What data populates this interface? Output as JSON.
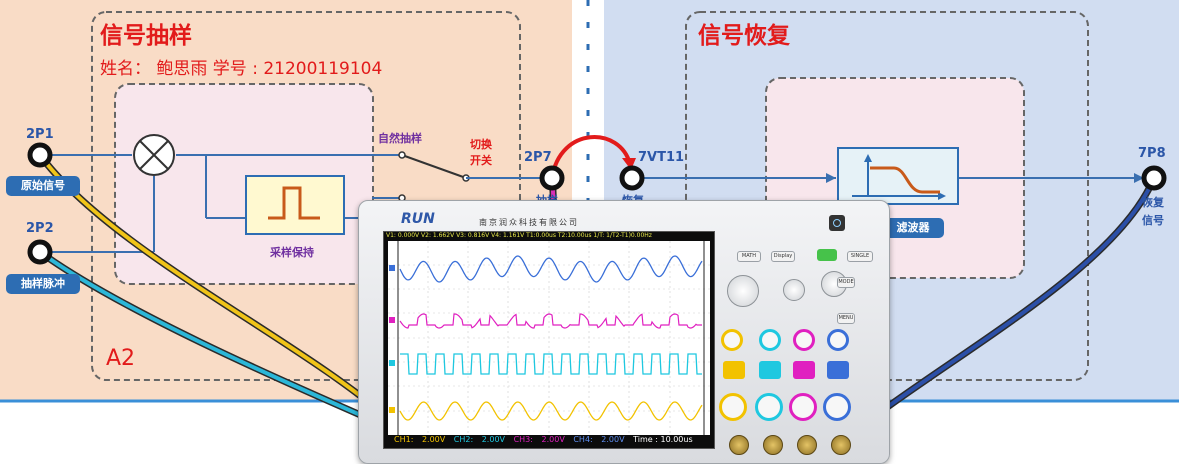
{
  "sampling_panel": {
    "title": "信号抽样",
    "student_line": "姓名： 鲍思雨  学号 : 21200119104",
    "corner_label": "A2",
    "port_2p1": "2P1",
    "port_2p2": "2P2",
    "port_2p7": "2P7",
    "btn_original_signal": "原始信号",
    "btn_sampling_pulse": "抽样脉冲",
    "natural_sampling": "自然抽样",
    "switch_label_line1": "切换",
    "switch_label_line2": "开关",
    "sample_hold": "采样保持",
    "port_2p7_sublabel": "抽样"
  },
  "recovery_panel": {
    "title": "信号恢复",
    "port_7vt11": "7VT11",
    "port_7p8": "7P8",
    "port_7vt11_sublabel": "恢复",
    "filter_label": "滤波器",
    "out_label_line1": "恢复",
    "out_label_line2": "信号"
  },
  "oscilloscope": {
    "brand": "RUN",
    "company": "南京润众科技有限公司",
    "measure_line": "V1: 0.000V  V2: 1.662V  V3: 0.816V  V4: 1.161V  T1:0.00us  T2:10.00us  1/T: 1/T2-T1)0.00Hz",
    "ch1": "CH1:",
    "ch1_val": "2.00V",
    "ch2": "CH2:",
    "ch2_val": "2.00V",
    "ch3": "CH3:",
    "ch3_val": "2.00V",
    "ch4": "CH4:",
    "ch4_val": "2.00V",
    "time": "Time : 10.00us",
    "btn_math": "MATH",
    "btn_display": "Display",
    "btn_single": "SINGLE",
    "btn_mode": "MODE",
    "btn_menu": "MENU",
    "trace_colors": {
      "ch1": "#f2c200",
      "ch2": "#1fc8e0",
      "ch3": "#e020c0",
      "ch4": "#3a6fd8"
    }
  },
  "colors": {
    "left_bg": "#f9dcc6",
    "right_bg": "#d1ddf1",
    "wire": "#3a6fb0",
    "title_red": "#e21b1b"
  }
}
